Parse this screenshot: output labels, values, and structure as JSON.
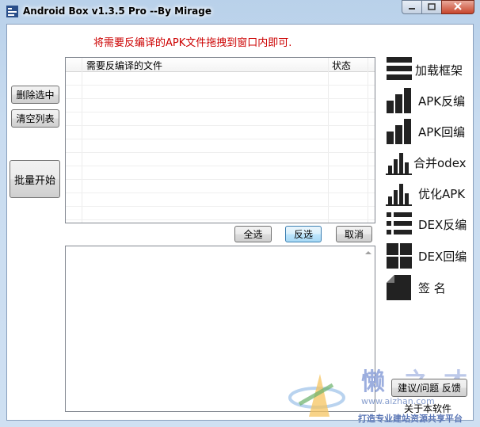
{
  "window": {
    "title": "Android Box v1.3.5 Pro --By Mirage",
    "controls": [
      "minimize-icon",
      "maximize-icon",
      "close-icon"
    ]
  },
  "hint": "将需要反编译的APK文件拖拽到窗口内即可.",
  "left_buttons": {
    "delete_selected": "删除选中",
    "clear_list": "清空列表",
    "batch_start": "批量开始"
  },
  "file_list": {
    "columns": [
      "需要反编译的文件",
      "状态"
    ],
    "rows": []
  },
  "list_buttons": {
    "select_all": "全选",
    "invert": "反选",
    "cancel": "取消"
  },
  "tools": [
    {
      "label": "加载框架",
      "icon": "list-icon"
    },
    {
      "label": "APK反编",
      "icon": "bar-chart-icon"
    },
    {
      "label": "APK回编",
      "icon": "bar-chart-icon"
    },
    {
      "label": "合并odex",
      "icon": "bar-chart-icon"
    },
    {
      "label": "优化APK",
      "icon": "bar-chart-icon"
    },
    {
      "label": "DEX反编",
      "icon": "bullet-list-icon"
    },
    {
      "label": "DEX回编",
      "icon": "grid-icon"
    },
    {
      "label": "签  名",
      "icon": "document-icon"
    }
  ],
  "feedback_button": "建议/问题 反馈",
  "about_link": "关于本软件",
  "watermark": {
    "url": "www.aizhan.com",
    "slogan": "打造专业建站资源共享平台"
  }
}
